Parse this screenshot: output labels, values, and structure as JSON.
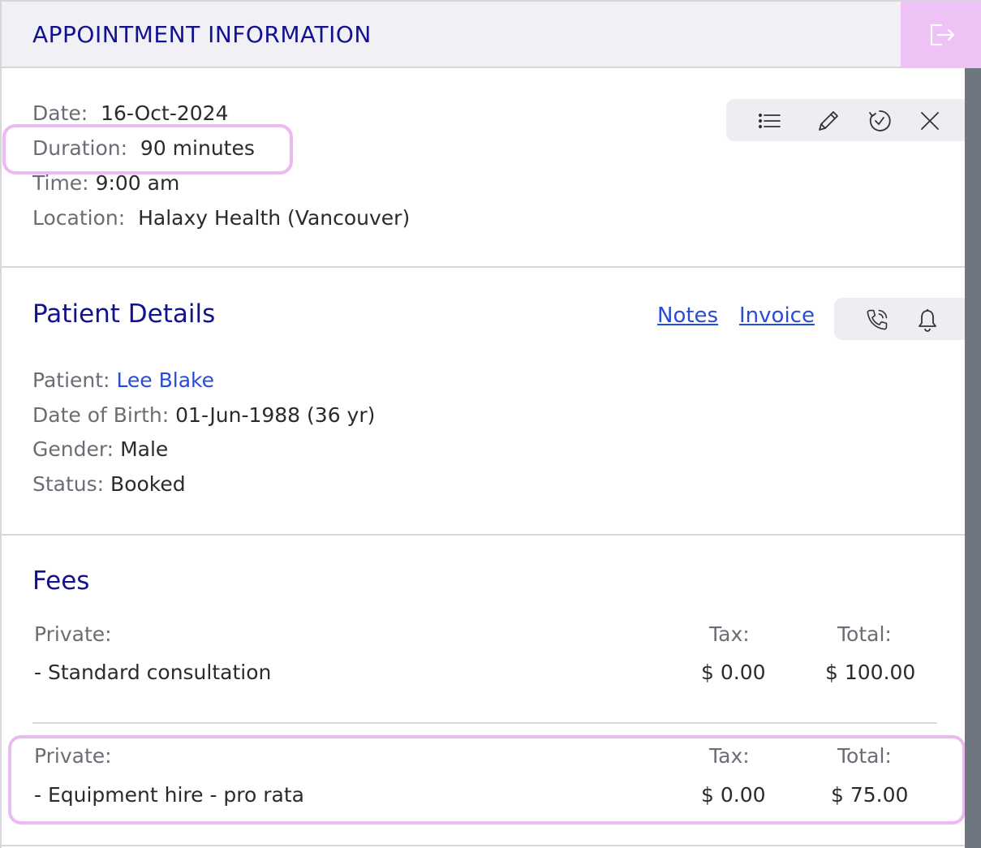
{
  "header": {
    "title": "APPOINTMENT INFORMATION",
    "exit_icon": "exit-icon"
  },
  "appointment": {
    "date_label": "Date:",
    "date_value": "16-Oct-2024",
    "duration_label": "Duration:",
    "duration_value": "90 minutes",
    "time_label": "Time:",
    "time_value": "9:00 am",
    "location_label": "Location:",
    "location_value": "Halaxy Health (Vancouver)",
    "toolbar_icons": [
      "list-icon",
      "pencil-icon",
      "clock-return-icon",
      "close-icon"
    ]
  },
  "patient": {
    "title": "Patient Details",
    "notes_link": "Notes",
    "invoice_link": "Invoice",
    "toolbar_icons": [
      "phone-icon",
      "bell-icon"
    ],
    "patient_label": "Patient:",
    "patient_value": "Lee Blake",
    "dob_label": "Date of Birth:",
    "dob_value": "01-Jun-1988 (36 yr)",
    "gender_label": "Gender:",
    "gender_value": "Male",
    "status_label": "Status:",
    "status_value": "Booked"
  },
  "fees": {
    "title": "Fees",
    "items": [
      {
        "type_label": "Private:",
        "tax_label": "Tax:",
        "total_label": "Total:",
        "name": "- Standard consultation",
        "tax": "$ 0.00",
        "total": "$ 100.00"
      },
      {
        "type_label": "Private:",
        "tax_label": "Tax:",
        "total_label": "Total:",
        "name": "- Equipment hire - pro rata",
        "tax": "$ 0.00",
        "total": "$ 75.00"
      }
    ]
  },
  "colors": {
    "accent_navy": "#12128f",
    "link_blue": "#2a4bd6",
    "highlight_pink": "#ecb9f2",
    "header_bg": "#f1f1f5"
  }
}
